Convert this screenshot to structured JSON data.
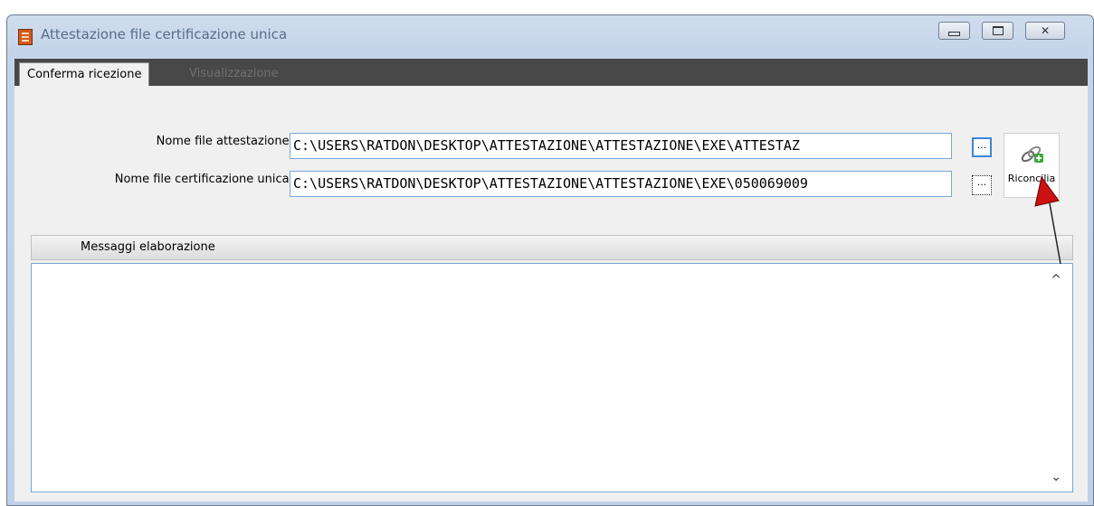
{
  "window": {
    "title": "Attestazione file certificazione unica",
    "buttons": {
      "minimize": "minimize",
      "maximize": "maximize",
      "close": "close"
    }
  },
  "tabs": [
    {
      "label": "Conferma ricezione",
      "active": true
    },
    {
      "label": "Visualizzazione",
      "active": false
    }
  ],
  "form": {
    "attestazione": {
      "label": "Nome file attestazione:",
      "value": "C:\\USERS\\RATDON\\DESKTOP\\ATTESTAZIONE\\ATTESTAZIONE\\EXE\\ATTESTAZ"
    },
    "certificazione": {
      "label": "Nome file certificazione unica:",
      "value": "C:\\USERS\\RATDON\\DESKTOP\\ATTESTAZIONE\\ATTESTAZIONE\\EXE\\050069009"
    },
    "browse_label": "...",
    "reconcile_label": "Riconcilia"
  },
  "messages": {
    "header": "Messaggi elaborazione",
    "content": ""
  },
  "colors": {
    "accent": "#3b87dc",
    "tabbar": "#484848",
    "arrow": "#cc0000"
  }
}
